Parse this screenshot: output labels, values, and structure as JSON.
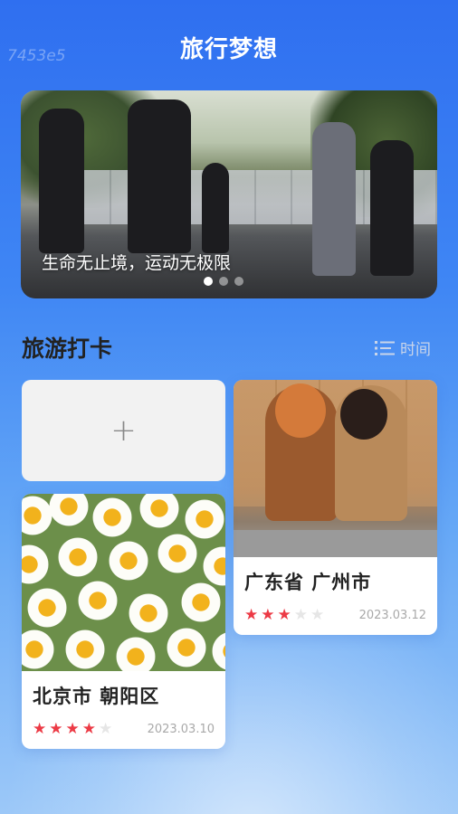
{
  "app": {
    "title": "旅行梦想",
    "watermark": "7453e5"
  },
  "banner": {
    "caption": "生命无止境，运动无极限",
    "slides": 3,
    "active_slide": 1
  },
  "section": {
    "title": "旅游打卡",
    "sort_label": "时间",
    "sort_icon": "list-icon"
  },
  "add_card": {
    "label": "+"
  },
  "cards": [
    {
      "title": "北京市 朝阳区",
      "rating": 4,
      "rating_max": 5,
      "date": "2023.03.10",
      "image": "daisy-flowers"
    },
    {
      "title": "广东省 广州市",
      "rating": 3,
      "rating_max": 5,
      "date": "2023.03.12",
      "image": "two-girls"
    }
  ],
  "colors": {
    "accent": "#3a7ef3",
    "star_on": "#ec3a45",
    "star_off": "#e6e6e6"
  }
}
